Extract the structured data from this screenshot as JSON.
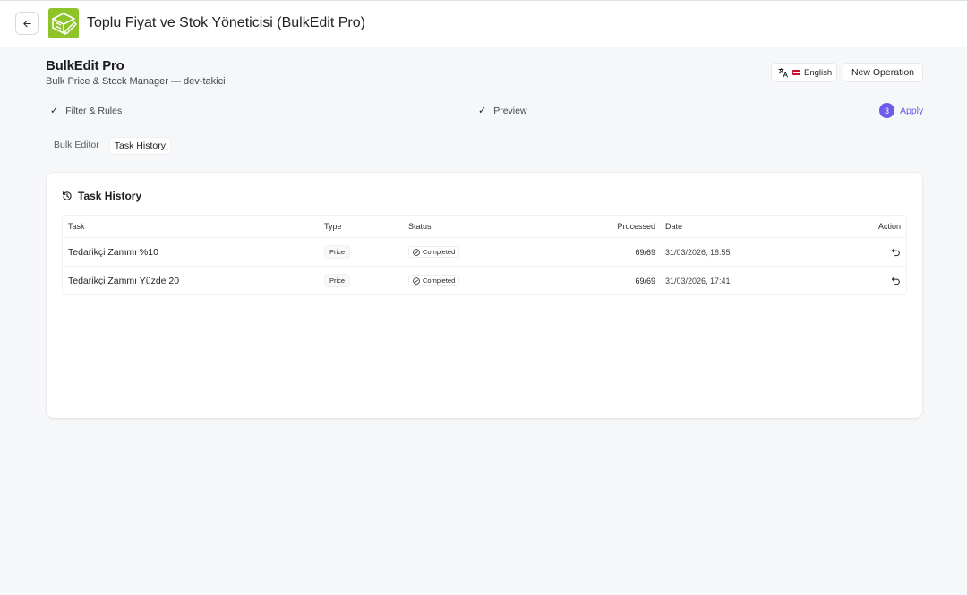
{
  "app": {
    "title": "Toplu Fiyat ve Stok Yöneticisi (BulkEdit Pro)"
  },
  "header": {
    "title": "BulkEdit Pro",
    "subtitle": "Bulk Price & Stock Manager — dev-takici",
    "language_label": "English",
    "new_operation_label": "New Operation"
  },
  "steps": [
    {
      "label": "Filter & Rules",
      "state": "done"
    },
    {
      "label": "Preview",
      "state": "done"
    },
    {
      "number": "3",
      "label": "Apply",
      "state": "active"
    }
  ],
  "tabs": [
    {
      "label": "Bulk Editor",
      "active": false
    },
    {
      "label": "Task History",
      "active": true
    }
  ],
  "history": {
    "title": "Task History",
    "columns": {
      "task": "Task",
      "type": "Type",
      "status": "Status",
      "processed": "Processed",
      "date": "Date",
      "action": "Action"
    },
    "rows": [
      {
        "task": "Tedarikçi Zammı %10",
        "type": "Price",
        "status": "Completed",
        "processed": "69/69",
        "date": "31/03/2026, 18:55"
      },
      {
        "task": "Tedarikçi Zammı Yüzde 20",
        "type": "Price",
        "status": "Completed",
        "processed": "69/69",
        "date": "31/03/2026, 17:41"
      }
    ]
  },
  "colors": {
    "accent": "#6d5ce8",
    "logo": "#8fc32a",
    "background": "#f6f7f9"
  },
  "icons": {
    "back": "arrow-left-icon",
    "logo": "bulk-edit-logo-icon",
    "language": "translate-icon",
    "check": "check-icon",
    "history": "history-icon",
    "status": "check-circle-icon",
    "undo": "undo-icon"
  }
}
